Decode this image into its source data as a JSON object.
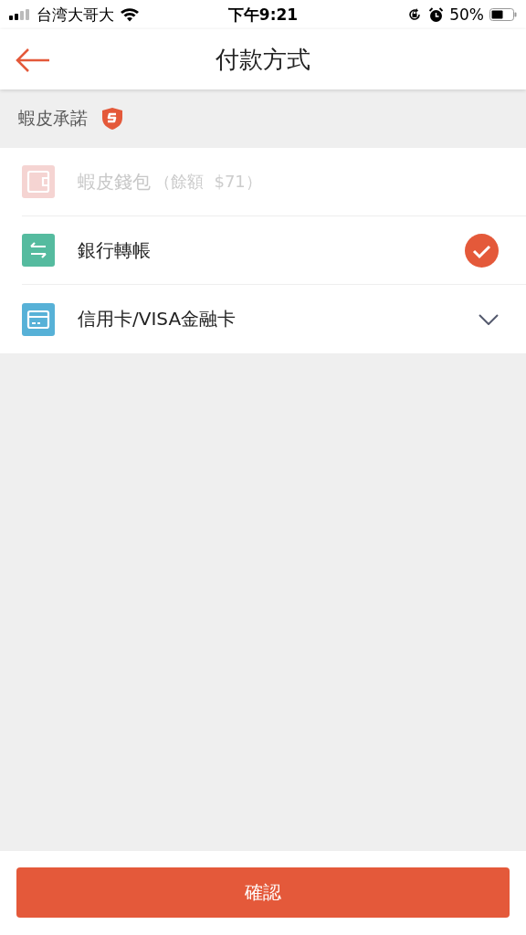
{
  "status_bar": {
    "carrier": "台湾大哥大",
    "time": "下午9:21",
    "battery": "50%"
  },
  "header": {
    "title": "付款方式"
  },
  "promise": {
    "label": "蝦皮承諾"
  },
  "methods": [
    {
      "kind": "wallet",
      "name": "蝦皮錢包",
      "note": "（餘額  $71）",
      "color": "#f5d4d2",
      "disabled": true,
      "selected": false,
      "expandable": false
    },
    {
      "kind": "bank",
      "name": "銀行轉帳",
      "color": "#55bb9f",
      "disabled": false,
      "selected": true,
      "expandable": false
    },
    {
      "kind": "card",
      "name": "信用卡/VISA金融卡",
      "color": "#57b1d7",
      "disabled": false,
      "selected": false,
      "expandable": true
    }
  ],
  "confirm_button": "確認"
}
